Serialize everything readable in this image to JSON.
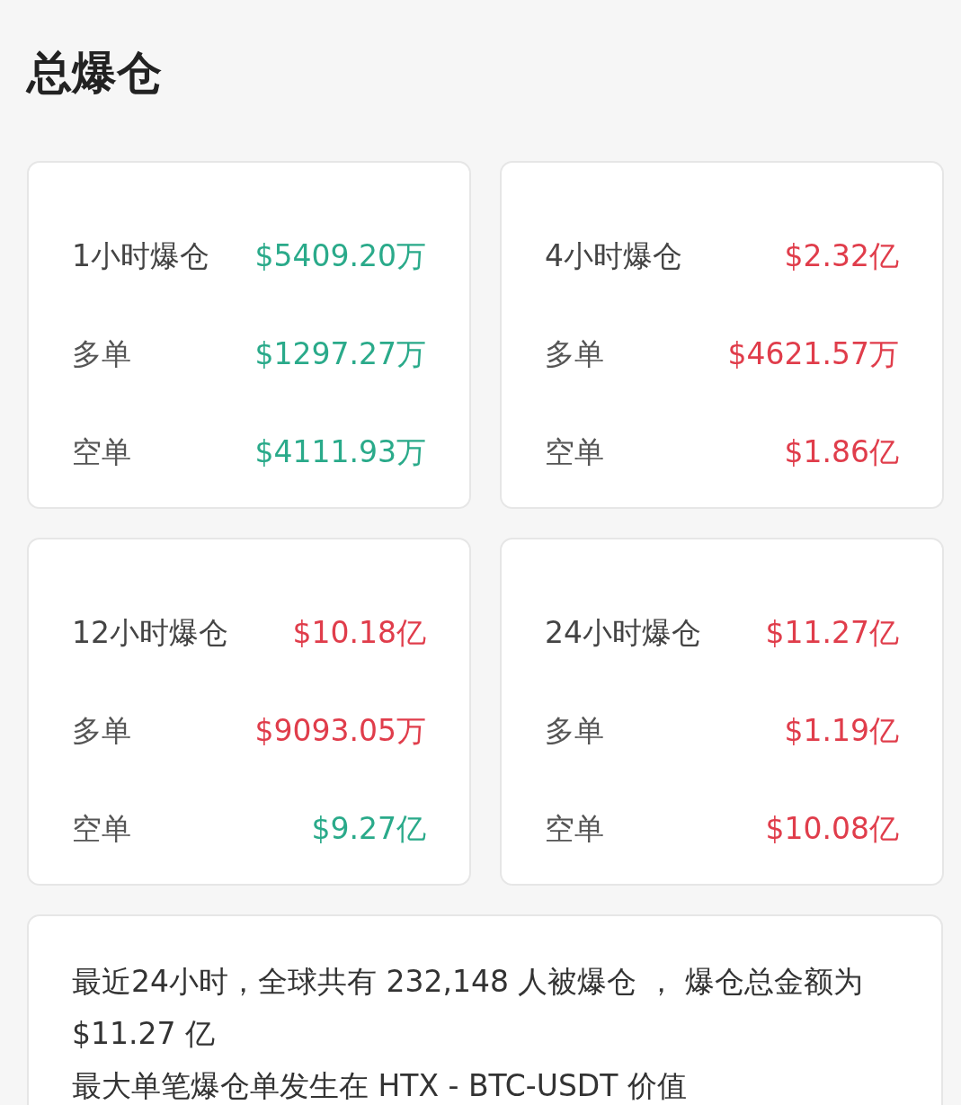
{
  "title": "总爆仓",
  "cards": [
    {
      "label": "1小时爆仓",
      "value": "$5409.20万",
      "color": "#2aaa8a",
      "rows": [
        {
          "label": "多单",
          "value": "$1297.27万",
          "color": "#2aaa8a"
        },
        {
          "label": "空单",
          "value": "$4111.93万",
          "color": "#2aaa8a"
        }
      ]
    },
    {
      "label": "4小时爆仓",
      "value": "$2.32亿",
      "color": "#e03d4b",
      "rows": [
        {
          "label": "多单",
          "value": "$4621.57万",
          "color": "#e03d4b"
        },
        {
          "label": "空单",
          "value": "$1.86亿",
          "color": "#e03d4b"
        }
      ]
    },
    {
      "label": "12小时爆仓",
      "value": "$10.18亿",
      "color": "#e03d4b",
      "rows": [
        {
          "label": "多单",
          "value": "$9093.05万",
          "color": "#e03d4b"
        },
        {
          "label": "空单",
          "value": "$9.27亿",
          "color": "#2aaa8a"
        }
      ]
    },
    {
      "label": "24小时爆仓",
      "value": "$11.27亿",
      "color": "#e03d4b",
      "rows": [
        {
          "label": "多单",
          "value": "$1.19亿",
          "color": "#e03d4b"
        },
        {
          "label": "空单",
          "value": "$10.08亿",
          "color": "#e03d4b"
        }
      ]
    }
  ],
  "summary": [
    "最近24小时，全球共有 232,148 人被爆仓 ， 爆仓总金额为 $11.27 亿",
    "最大单笔爆仓单发生在 HTX - BTC-USDT 价值"
  ]
}
